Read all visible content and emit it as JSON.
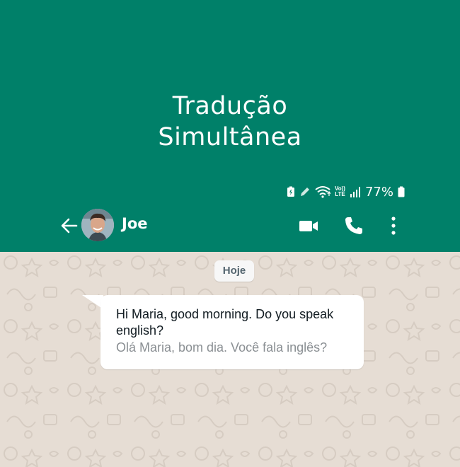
{
  "headline": {
    "line1": "Tradução",
    "line2": "Simultânea"
  },
  "status_bar": {
    "battery_percent": "77%",
    "volte_label": "Vo))",
    "lte_label": "LTE"
  },
  "chat_header": {
    "contact_name": "Joe"
  },
  "chat": {
    "date_chip": "Hoje",
    "message": {
      "text": "Hi Maria, good morning. Do you speak english?",
      "translation": "Olá Maria, bom dia. Você fala inglês?"
    }
  },
  "colors": {
    "header_green": "#008069",
    "chat_background": "#e6ddd4",
    "bubble": "#ffffff",
    "translation_text": "#8a8f93"
  },
  "icons": [
    "battery-saver-icon",
    "pen-icon",
    "wifi-icon",
    "volte-icon",
    "signal-icon",
    "battery-icon",
    "back-arrow-icon",
    "video-call-icon",
    "phone-icon",
    "more-vert-icon",
    "chat-doodle-pattern"
  ]
}
